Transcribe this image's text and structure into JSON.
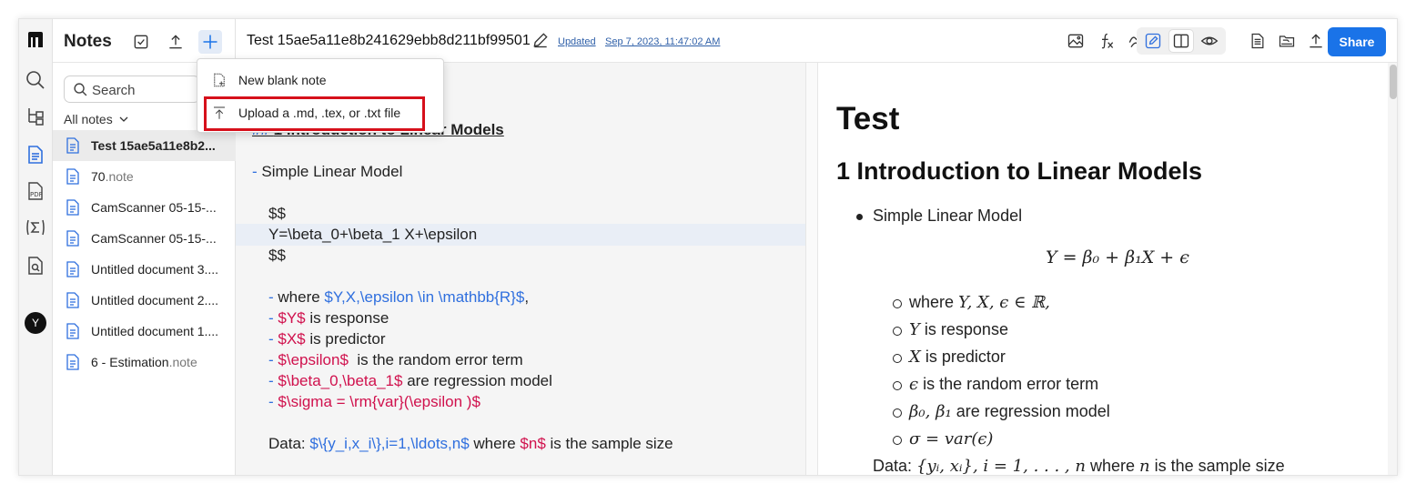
{
  "app": {
    "notes_title": "Notes",
    "search_placeholder": "Search",
    "filter_label": "All notes"
  },
  "notes": [
    {
      "name": "Test 15ae5a11e8b2...",
      "ext": "",
      "selected": true
    },
    {
      "name": "70",
      "ext": ".note",
      "selected": false
    },
    {
      "name": "CamScanner 05-15-...",
      "ext": "",
      "selected": false
    },
    {
      "name": "CamScanner 05-15-...",
      "ext": "",
      "selected": false
    },
    {
      "name": "Untitled document 3....",
      "ext": "",
      "selected": false
    },
    {
      "name": "Untitled document 2....",
      "ext": "",
      "selected": false
    },
    {
      "name": "Untitled document 1....",
      "ext": "",
      "selected": false
    },
    {
      "name": "6 - Estimation",
      "ext": ".note",
      "selected": false
    }
  ],
  "menu": {
    "new_blank": "New blank note",
    "upload": "Upload a .md, .tex, or .txt file"
  },
  "topbar": {
    "doc_title": "Test 15ae5a11e8b241629ebb8d211bf99501",
    "updated_label": "Updated",
    "updated_date": "Sep 7, 2023, 11:47:02 AM",
    "share_label": "Share"
  },
  "avatar_letter": "Y",
  "editor": {
    "heading_line": "1 Introduction to Linear Models",
    "line_bullet": "Simple Linear Model",
    "line_dollars1": "$$",
    "line_formula": "Y=\\beta_0+\\beta_1 X+\\epsilon",
    "line_dollars2": "$$",
    "line_where_pre": "where ",
    "line_where_math": "$Y,X,\\epsilon \\in \\mathbb{R}$",
    "line_where_post": ",",
    "line_resp_math": "$Y$",
    "line_resp_post": " is response",
    "line_pred_math": "$X$",
    "line_pred_post": " is predictor",
    "line_eps_math": "$\\epsilon$",
    "line_eps_post": "  is the random error term",
    "line_beta_math": "$\\beta_0,\\beta_1$",
    "line_beta_post": " are regression model",
    "line_sigma_math": "$\\sigma = \\rm{var}(\\epsilon )$",
    "line_data_pre": "Data: ",
    "line_data_math": "$\\{y_i,x_i\\},i=1,\\ldots,n$",
    "line_data_mid": " where ",
    "line_data_math2": "$n$",
    "line_data_post": " is the sample size"
  },
  "preview": {
    "title": "Test",
    "heading": "1 Introduction to Linear Models",
    "bullet": "Simple Linear Model",
    "formula": "Y = β₀ + β₁X + ϵ",
    "where_text": "where",
    "where_math": "Y, X, ϵ ∈ ℝ,",
    "resp_math": "Y",
    "resp_text": "is response",
    "pred_math": "X",
    "pred_text": "is predictor",
    "eps_math": "ϵ",
    "eps_text": "is the random error term",
    "beta_math": "β₀, β₁",
    "beta_text": "are regression model",
    "sigma_math": "σ = var(ϵ)",
    "data_pre": "Data:",
    "data_math": "{yᵢ, xᵢ}, i = 1, . . . , n",
    "data_mid": "where",
    "data_n": "n",
    "data_post": "is the sample size"
  },
  "colors": {
    "accent": "#1a73e8",
    "highlight_border": "#d6101b",
    "latex_blue": "#2f6fde",
    "latex_red": "#d0114d"
  }
}
